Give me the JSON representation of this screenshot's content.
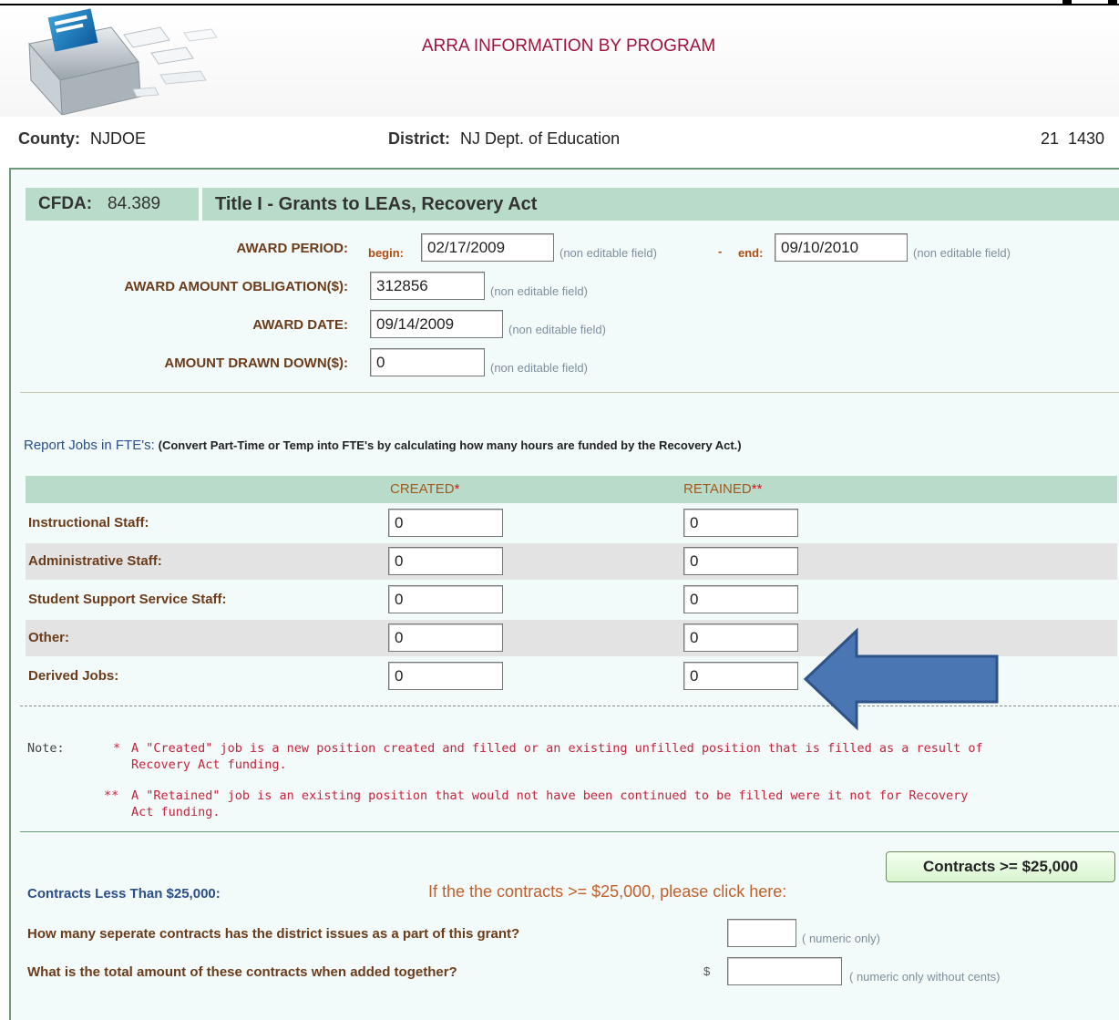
{
  "header": {
    "title": "ARRA INFORMATION BY PROGRAM",
    "county_label": "County:",
    "county_value": "NJDOE",
    "district_label": "District:",
    "district_value": "NJ Dept. of Education",
    "district_code": "21  1430"
  },
  "cfda": {
    "label": "CFDA:",
    "number": "84.389",
    "title": "Title I - Grants to LEAs, Recovery Act"
  },
  "award": {
    "period_label": "AWARD PERIOD:",
    "begin_label": "begin:",
    "begin_value": "02/17/2009",
    "dash": "-",
    "end_label": "end:",
    "end_value": "09/10/2010",
    "obligation_label": "AWARD AMOUNT OBLIGATION($):",
    "obligation_value": "312856",
    "date_label": "AWARD DATE:",
    "date_value": "09/14/2009",
    "drawn_label": "AMOUNT DRAWN DOWN($):",
    "drawn_value": "0",
    "non_editable": "(non editable field)"
  },
  "fte": {
    "heading": "Report Jobs in FTE's:",
    "instruction": "(Convert Part-Time or Temp into FTE's by calculating how many hours are funded by the Recovery Act.)",
    "col_created": "CREATED",
    "col_created_mark": "*",
    "col_retained": "RETAINED",
    "col_retained_mark": "**",
    "rows": [
      {
        "label": "Instructional Staff:",
        "created": "0",
        "retained": "0"
      },
      {
        "label": "Administrative Staff:",
        "created": "0",
        "retained": "0"
      },
      {
        "label": "Student Support Service Staff:",
        "created": "0",
        "retained": "0"
      },
      {
        "label": "Other:",
        "created": "0",
        "retained": "0"
      },
      {
        "label": "Derived Jobs:",
        "created": "0",
        "retained": "0"
      }
    ]
  },
  "notes": {
    "label": "Note:",
    "created_mark": "*",
    "created_text_1": "A \"Created\" job is a new position created and filled or an existing unfilled position that is filled as a result of",
    "created_text_2": "Recovery Act funding.",
    "retained_mark": "**",
    "retained_text_1": "A \"Retained\" job is an existing position that would not have been continued to be filled were it not for Recovery",
    "retained_text_2": "Act funding."
  },
  "contracts": {
    "label": "Contracts Less Than $25,000:",
    "prompt": "If the the contracts >= $25,000, please click here:",
    "button": "Contracts >= $25,000",
    "q1": "How many seperate contracts has the district issues as a part of this grant?",
    "q1_value": "",
    "q1_hint": "( numeric only)",
    "q2": "What is the total amount of these contracts when added together?",
    "q2_currency": "$",
    "q2_value": "",
    "q2_hint": "( numeric only without cents)"
  },
  "annotation": {
    "icon": "blue-arrow-left-icon",
    "color": "#4a77b4"
  },
  "colors": {
    "title": "#a3123a",
    "band": "#b9dcca",
    "label": "#6b3c1a",
    "note": "#c6233d"
  }
}
